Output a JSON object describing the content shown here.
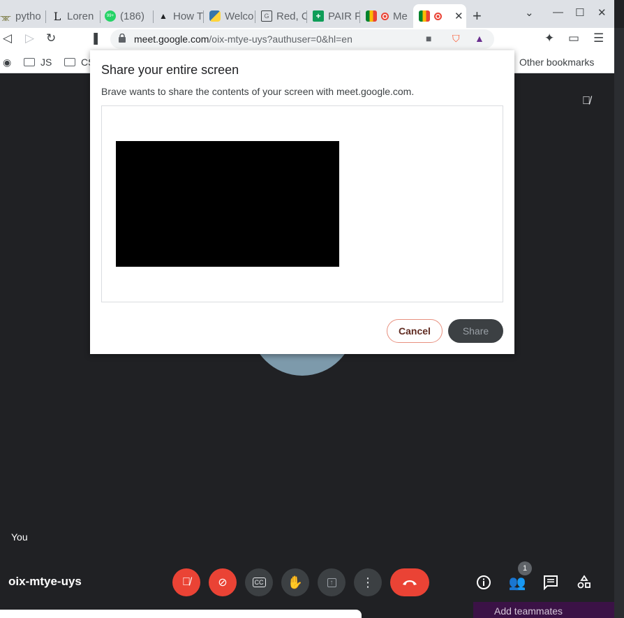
{
  "browser": {
    "tabs": [
      {
        "label": "pytho",
        "icon": "plant-icon"
      },
      {
        "label": "Loren",
        "icon": "letter-l-icon"
      },
      {
        "label": "(186) ",
        "icon": "chat-badge-icon",
        "badge": "99+"
      },
      {
        "label": "How T",
        "icon": "linux-penguin-icon"
      },
      {
        "label": "Welco",
        "icon": "python-icon"
      },
      {
        "label": "Red, C",
        "icon": "book-icon"
      },
      {
        "label": "PAIR F",
        "icon": "green-plus-icon"
      },
      {
        "label": "Me",
        "icon": "meet-recording-icon"
      },
      {
        "label": "",
        "icon": "meet-recording-icon",
        "active": true
      }
    ],
    "url_host": "meet.google.com",
    "url_rest": "/oix-mtye-uys?authuser=0&hl=en",
    "bookmarks": [
      {
        "label": "JS"
      },
      {
        "label": "CS"
      }
    ],
    "other_bookmarks": "Other bookmarks"
  },
  "dialog": {
    "title": "Share your entire screen",
    "subtitle": "Brave wants to share the contents of your screen with meet.google.com.",
    "cancel_label": "Cancel",
    "share_label": "Share"
  },
  "meet": {
    "self_label": "You",
    "meeting_code": "oix-mtye-uys",
    "participants_count": "1",
    "add_teammates": "Add teammates"
  },
  "colors": {
    "meet_bg": "#202124",
    "end_call_red": "#ea4335",
    "avatar": "#7d9aab"
  }
}
